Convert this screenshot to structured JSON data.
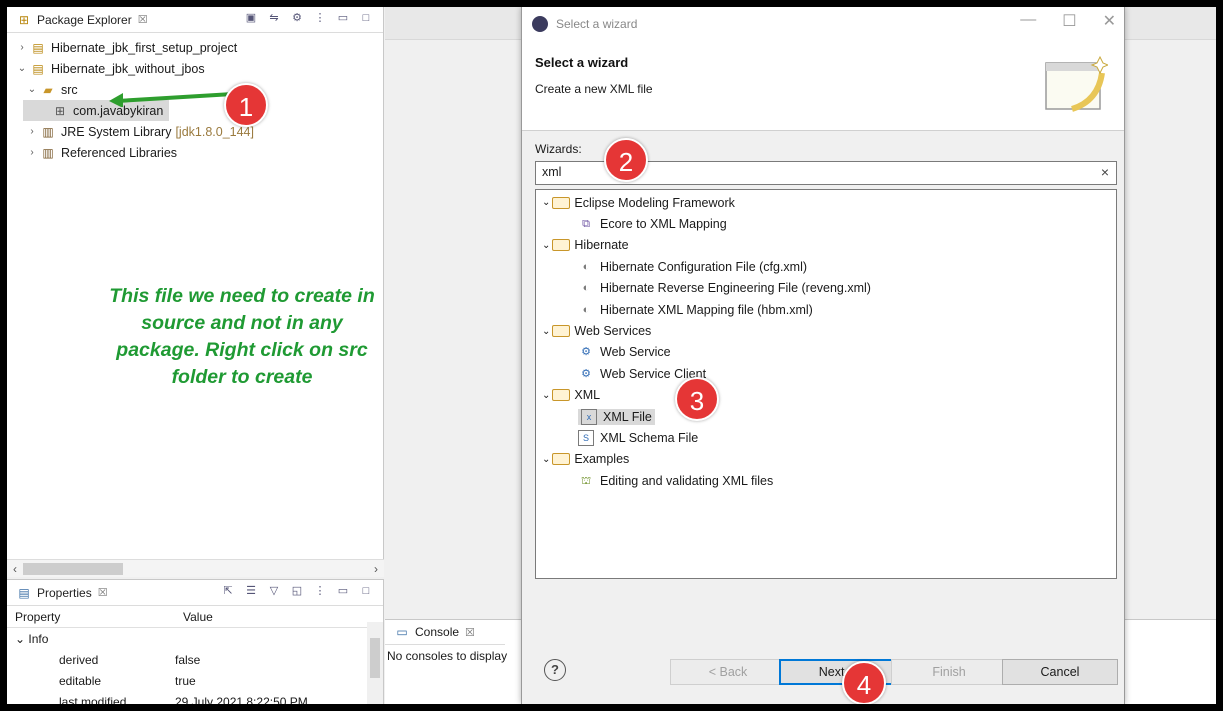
{
  "package_explorer": {
    "title": "Package Explorer",
    "close": "☒",
    "tree": [
      {
        "label": "Hibernate_jbk_first_setup_project",
        "twisty": "›"
      },
      {
        "label": "Hibernate_jbk_without_jbos",
        "twisty": "⌄"
      },
      {
        "label": "src",
        "twisty": "⌄"
      },
      {
        "label": "com.javabykiran"
      },
      {
        "label": "JRE System Library",
        "suffix": "[jdk1.8.0_144]",
        "twisty": "›"
      },
      {
        "label": "Referenced Libraries",
        "twisty": "›"
      }
    ],
    "scroll_left": "‹",
    "scroll_right": "›"
  },
  "annotation": "This file we need to create in source and not in any package. Right click on src folder to create",
  "properties": {
    "title": "Properties",
    "close": "☒",
    "col_property": "Property",
    "col_value": "Value",
    "group": "Info",
    "rows": [
      {
        "k": "derived",
        "v": "false"
      },
      {
        "k": "editable",
        "v": "true"
      },
      {
        "k": "last modified",
        "v": "29 July 2021 8:22:50 PM"
      }
    ]
  },
  "console": {
    "title": "Console",
    "close": "☒",
    "body": "No consoles to display"
  },
  "dialog": {
    "window_title": "Select a wizard",
    "heading": "Select a wizard",
    "subheading": "Create a new XML file",
    "wizards_label": "Wizards:",
    "filter_value": "xml",
    "filter_clear": "×",
    "groups": [
      {
        "label": "Eclipse Modeling Framework",
        "items": [
          "Ecore to XML Mapping"
        ]
      },
      {
        "label": "Hibernate",
        "items": [
          "Hibernate Configuration File (cfg.xml)",
          "Hibernate Reverse Engineering File (reveng.xml)",
          "Hibernate XML Mapping file (hbm.xml)"
        ]
      },
      {
        "label": "Web Services",
        "items": [
          "Web Service",
          "Web Service Client"
        ]
      },
      {
        "label": "XML",
        "items": [
          "XML File",
          "XML Schema File"
        ]
      },
      {
        "label": "Examples",
        "items": [
          "Editing and validating XML files"
        ]
      }
    ],
    "buttons": {
      "help": "?",
      "back": "< Back",
      "next": "Next >",
      "finish": "Finish",
      "cancel": "Cancel"
    }
  },
  "callouts": [
    "1",
    "2",
    "3",
    "4"
  ],
  "colors": {
    "annotation": "#1f9a33",
    "badge": "#e53636",
    "arrow": "#2e9e2e",
    "primary_button_border": "#0078d7"
  }
}
